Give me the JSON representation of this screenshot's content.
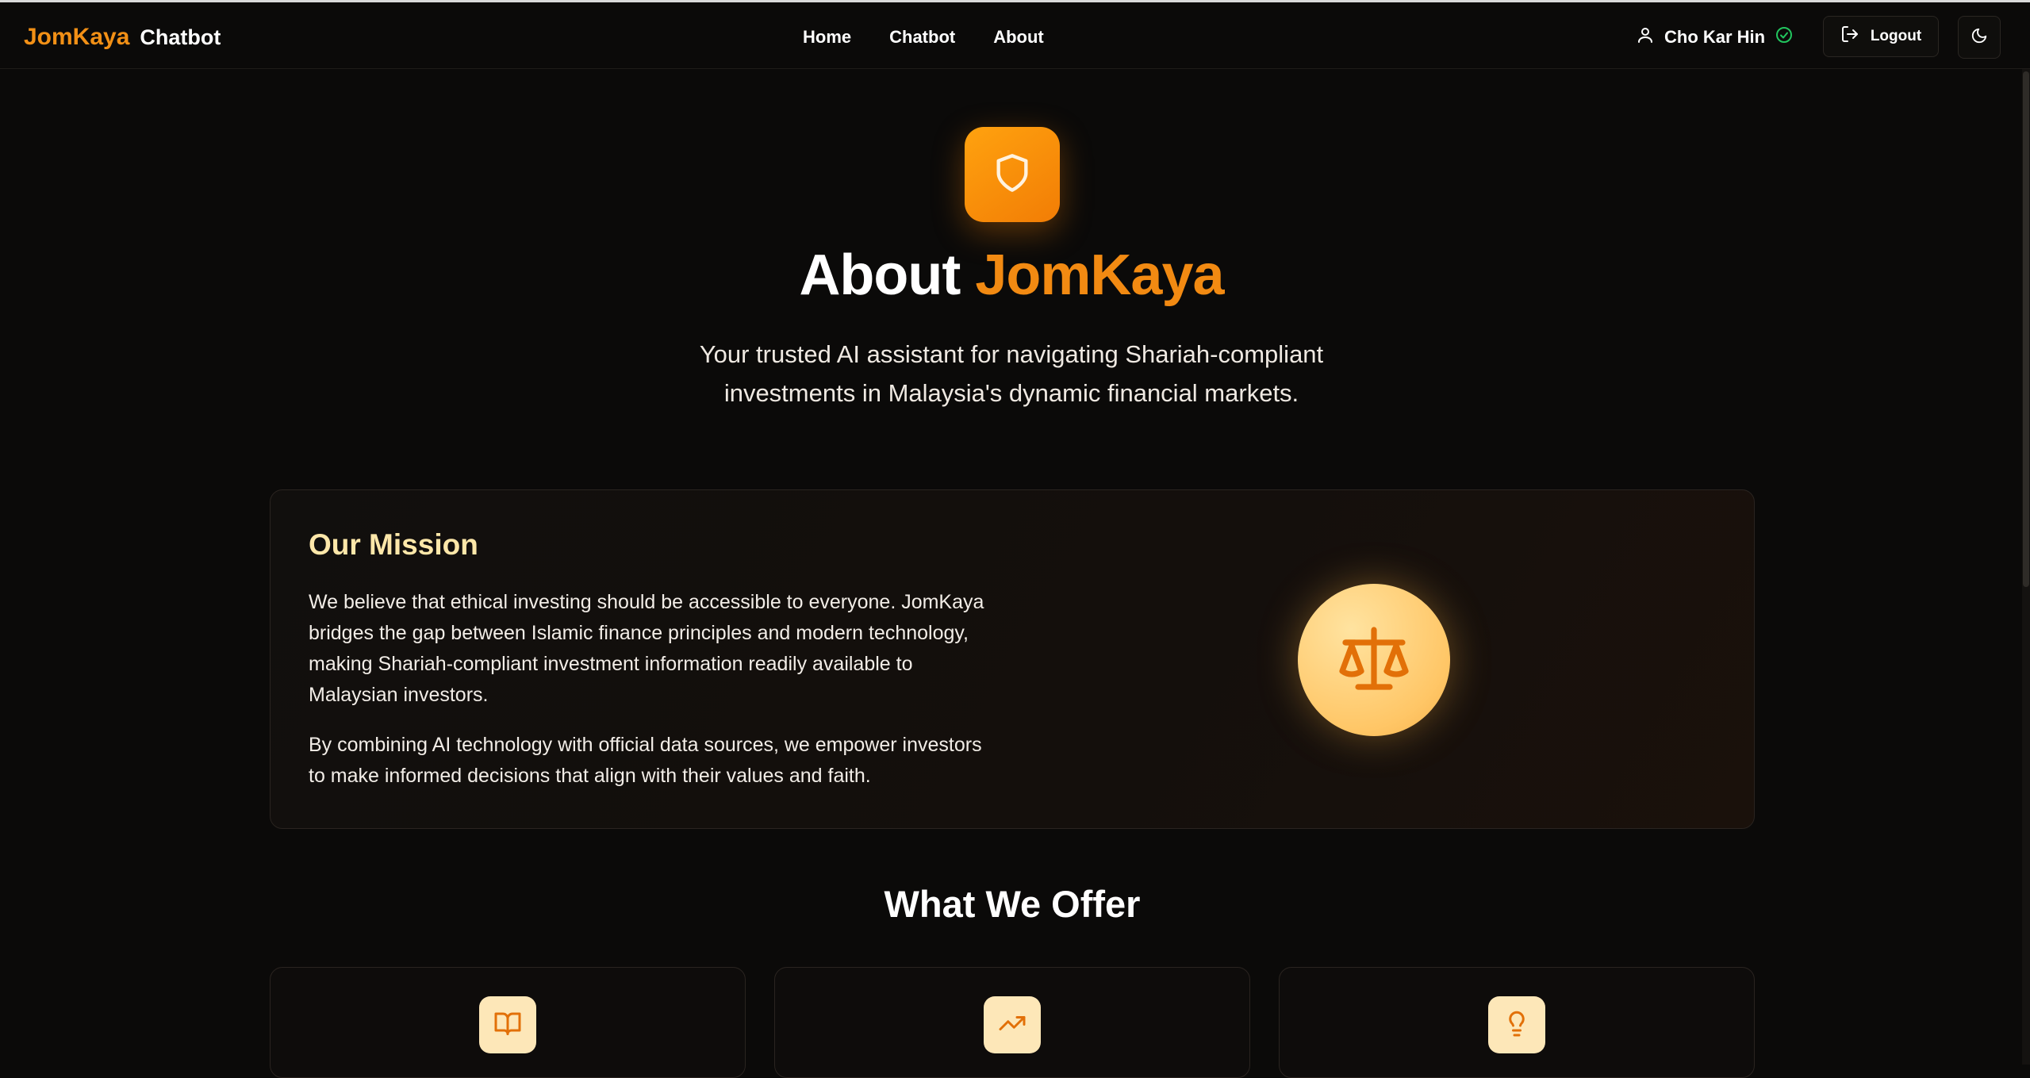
{
  "nav": {
    "brand_primary": "JomKaya",
    "brand_secondary": "Chatbot",
    "links": [
      "Home",
      "Chatbot",
      "About"
    ],
    "user_name": "Cho Kar Hin",
    "logout_label": "Logout"
  },
  "hero": {
    "title_prefix": "About",
    "title_accent": "JomKaya",
    "subtitle": "Your trusted AI assistant for navigating Shariah-compliant investments in Malaysia's dynamic financial markets."
  },
  "mission": {
    "title": "Our Mission",
    "paragraph1": "We believe that ethical investing should be accessible to everyone. JomKaya bridges the gap between Islamic finance principles and modern technology, making Shariah-compliant investment information readily available to Malaysian investors.",
    "paragraph2": "By combining AI technology with official data sources, we empower investors to make informed decisions that align with their values and faith."
  },
  "offer": {
    "title": "What We Offer",
    "cards": [
      {
        "icon": "book-open-icon"
      },
      {
        "icon": "trending-up-icon"
      },
      {
        "icon": "lightbulb-icon"
      }
    ]
  },
  "colors": {
    "accent": "#f28a12",
    "background": "#0b0a09",
    "mission_title": "#fde7a9",
    "verified_green": "#22c55e"
  }
}
